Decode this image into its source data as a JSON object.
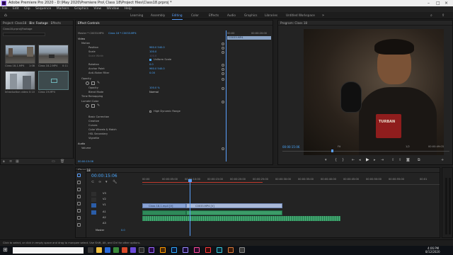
{
  "window": {
    "title": "Adobe Premiere Pro 2020 - D:\\May 2020\\Premiere Pro\\ Class 18\\Project files\\Class18.prproj *"
  },
  "menu": [
    "File",
    "Edit",
    "Clip",
    "Sequence",
    "Markers",
    "Graphics",
    "View",
    "Window",
    "Help"
  ],
  "workspaces": {
    "items": [
      "Learning",
      "Assembly",
      "Editing",
      "Color",
      "Effects",
      "Audio",
      "Graphics",
      "Libraries",
      "Untitled Workspace"
    ],
    "active": "Editing"
  },
  "project_panel": {
    "tabs": [
      "Project: Class18",
      "Bin: Footage",
      "Effects"
    ],
    "path": "Class18.prproj\\Footage",
    "clips": [
      {
        "name": "Class 18-1.MP4",
        "duration": "1:08"
      },
      {
        "name": "Class 18-2.MP4",
        "duration": "0:11"
      },
      {
        "name": "Introduction video",
        "duration": "0:10"
      },
      {
        "name": "Class 19.MP4",
        "duration": ""
      }
    ]
  },
  "effect_controls": {
    "tab": "Effect Controls",
    "source": "Master * C0033.MP4",
    "sequence": "Class 18 * C0033.MP4",
    "ruler_time": "00:00",
    "end_time": "00:00:20:00",
    "clip_label": "C0033.MP4",
    "section": "Video",
    "rows": [
      {
        "label": "Motion",
        "value": ""
      },
      {
        "label": "Position",
        "value": "960.0    540.0"
      },
      {
        "label": "Scale",
        "value": "100.0"
      },
      {
        "label": "Scale Width",
        "value": "100.0"
      },
      {
        "label": "",
        "value": "Uniform Scale"
      },
      {
        "label": "Rotation",
        "value": "0.0"
      },
      {
        "label": "Anchor Point",
        "value": "960.0    540.0"
      },
      {
        "label": "Anti-flicker Filter",
        "value": "0.00"
      },
      {
        "label": "Opacity",
        "value": ""
      },
      {
        "label": "Opacity",
        "value": "100.0 %"
      },
      {
        "label": "Blend Mode",
        "value": "Normal"
      },
      {
        "label": "Time Remapping",
        "value": ""
      },
      {
        "label": "Lumetri Color",
        "value": ""
      },
      {
        "label": "",
        "value": "High Dynamic Range"
      },
      {
        "label": "Basic Correction",
        "value": ""
      },
      {
        "label": "Creative",
        "value": ""
      },
      {
        "label": "Curves",
        "value": ""
      },
      {
        "label": "Color Wheels & Match",
        "value": ""
      },
      {
        "label": "HSL Secondary",
        "value": ""
      },
      {
        "label": "Vignette",
        "value": ""
      },
      {
        "label": "Audio",
        "value": ""
      },
      {
        "label": "Volume",
        "value": ""
      }
    ],
    "timecode": "00:00:15:06"
  },
  "program_monitor": {
    "title": "Program: Class 18",
    "timecode": "00:00:15:06",
    "fit": "Fit",
    "quality": "1/2",
    "duration": "00:00:49:03",
    "mug_text": "TURBAN"
  },
  "timeline": {
    "tab": "Class 18",
    "timecode": "00:00:15:06",
    "ruler": [
      "00:00",
      "00:00:05:00",
      "00:00:10:00",
      "00:00:15:00",
      "00:00:20:00",
      "00:00:25:00",
      "00:00:30:00",
      "00:00:35:00",
      "00:00:40:00",
      "00:00:45:00",
      "00:00:50:00",
      "00:00:55:00",
      "00:01"
    ],
    "tracks": [
      "V3",
      "V2",
      "V1",
      "A1",
      "A2",
      "A3",
      "Master"
    ],
    "master_value": "0.0",
    "clips": [
      {
        "label": "Class 18-1.mp4 [V]"
      },
      {
        "label": "C0033.MP4 [V]"
      }
    ]
  },
  "status_bar": {
    "text": "Click to select, or click in empty space and drag to marquee select. Use Shift, Alt, and Ctrl for other options."
  },
  "taskbar": {
    "time": "4:06 PM",
    "date": "8/12/2020"
  }
}
